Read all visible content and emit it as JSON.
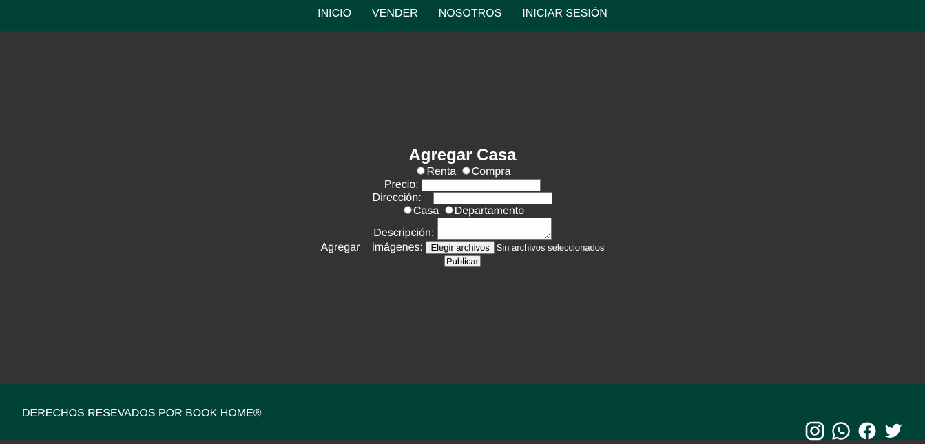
{
  "nav": {
    "items": [
      {
        "label": "INICIO"
      },
      {
        "label": "VENDER"
      },
      {
        "label": "NOSOTROS"
      },
      {
        "label": "INICIAR SESIÓN"
      }
    ]
  },
  "form": {
    "title": "Agregar Casa",
    "operation_options": [
      "Renta",
      "Compra"
    ],
    "price_label": "Precio:",
    "price_value": "",
    "address_label": "Dirección:",
    "address_value": "",
    "property_options": [
      "Casa",
      "Departamento"
    ],
    "description_label": "Descripción:",
    "description_value": "",
    "images_label_1": "Agregar",
    "images_label_2": "imágenes:",
    "file_button_label": "Elegir archivos",
    "file_status": "Sin archivos seleccionados",
    "submit_label": "Publicar"
  },
  "footer": {
    "copyright": "DERECHOS RESEVADOS POR BOOK HOME®",
    "social_icons": [
      "instagram-icon",
      "whatsapp-icon",
      "facebook-icon",
      "twitter-icon"
    ]
  },
  "colors": {
    "brand_green": "#004236",
    "background": "#333333",
    "text": "#ffffff"
  }
}
